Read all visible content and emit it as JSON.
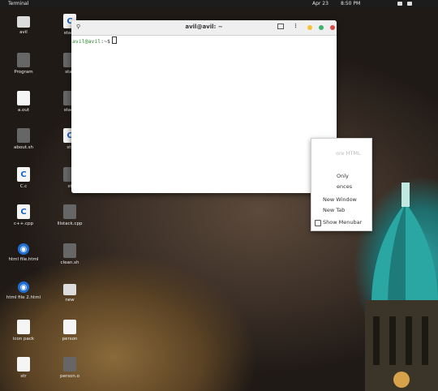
{
  "topbar": {
    "app_name": "Terminal",
    "date": "Apr 23",
    "time": "8:50 PM"
  },
  "desktop_icons": [
    {
      "label": "avil",
      "kind": "folder"
    },
    {
      "label": "stack",
      "kind": "file-c"
    },
    {
      "label": "Program",
      "kind": "dark"
    },
    {
      "label": "stac",
      "kind": "dark"
    },
    {
      "label": "a.out",
      "kind": "file"
    },
    {
      "label": "stack",
      "kind": "dark"
    },
    {
      "label": "about.sh",
      "kind": "dark"
    },
    {
      "label": "str",
      "kind": "file-c"
    },
    {
      "label": "C.c",
      "kind": "file-c"
    },
    {
      "label": "st",
      "kind": "dark"
    },
    {
      "label": "c++.cpp",
      "kind": "file-c"
    },
    {
      "label": "lllstack.cpp",
      "kind": "dark"
    },
    {
      "label": "html file.html",
      "kind": "web"
    },
    {
      "label": "clean.sh",
      "kind": "dark"
    },
    {
      "label": "html file 2.html",
      "kind": "web"
    },
    {
      "label": "new",
      "kind": "folder"
    },
    {
      "label": "icon pack",
      "kind": "file"
    },
    {
      "label": "person",
      "kind": "file"
    },
    {
      "label": "str",
      "kind": "file"
    },
    {
      "label": "person.o",
      "kind": "dark"
    }
  ],
  "terminal": {
    "title": "avil@avil: ~",
    "prompt_user": "avil@avil",
    "prompt_rest": ":~$",
    "controls": {
      "minimize_color": "#f4c430",
      "maximize_color": "#3cb371",
      "close_color": "#e04848"
    }
  },
  "context_menu": {
    "faint_item": "ore HTML",
    "items": [
      "Only",
      "ences",
      "New Window",
      "New Tab"
    ],
    "checkbox_label": "Show Menubar"
  }
}
